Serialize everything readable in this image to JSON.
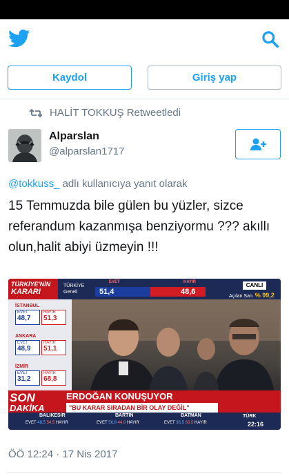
{
  "header": {
    "signup_label": "Kaydol",
    "login_label": "Giriş yap"
  },
  "tweet": {
    "retweeted_by": "HALİT TOKKUŞ Retweetledi",
    "user_name": "Alparslan",
    "user_handle": "@alparslan1717",
    "reply_mention": "@tokkuss_",
    "reply_suffix": " adlı kullanıcıya yanıt olarak",
    "text": "15 Temmuzda bile gülen bu yüzler, sizce referandum kazanmışa benziyormu ??? akıllı olun,halit abiyi üzmeyin !!!",
    "timestamp": "ÖÖ 12:24 · 17 Nis 2017"
  },
  "media": {
    "logo_line1": "TÜRKİYE'NİN",
    "logo_line2": "KARARI",
    "country": "TÜRKİYE",
    "country_sub": "Geneli",
    "evet_label": "EVET",
    "hayir_label": "HAYIR",
    "evet_value": "51,4",
    "hayir_value": "48,6",
    "live": "CANLI",
    "opened_label": "Açılan San.",
    "opened_pct": "% 99,2",
    "cities": [
      {
        "name": "İSTANBUL",
        "evet": "48,7",
        "hayir": "51,3"
      },
      {
        "name": "ANKARA",
        "evet": "48,9",
        "hayir": "51,1"
      },
      {
        "name": "İZMİR",
        "evet": "31,2",
        "hayir": "68,8"
      }
    ],
    "son": "SON",
    "dakika": "DAKİKA",
    "headline": "ERDOĞAN KONUŞUYOR",
    "subline": "\"BU KARAR SIRADAN BİR OLAY DEĞİL\"",
    "channel": "CNN",
    "channel_sub": "TÜRK",
    "time": "22:16",
    "bottom_cities": [
      {
        "name": "BALIKESİR",
        "evet": "48,5",
        "hayir": "54,5"
      },
      {
        "name": "BARTIN",
        "evet": "56,8",
        "hayir": "44,0"
      },
      {
        "name": "BATMAN",
        "evet": "36,5",
        "hayir": "63,5"
      }
    ],
    "evet_short": "EVET",
    "hayir_short": "HAYIR"
  },
  "colors": {
    "brand": "#1da1f2",
    "muted": "#657786"
  }
}
